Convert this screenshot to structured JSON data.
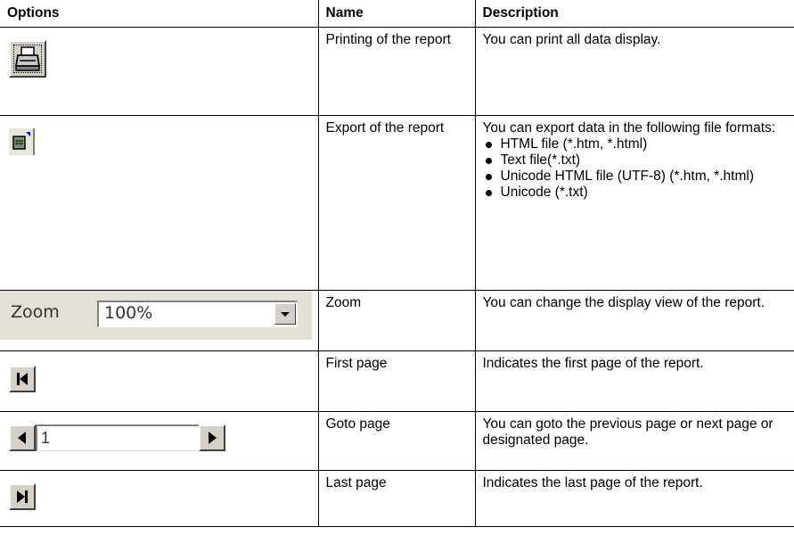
{
  "headers": {
    "options": "Options",
    "name": "Name",
    "description": "Description"
  },
  "rows": [
    {
      "name": "Printing of the report",
      "description": "You can print all data display."
    },
    {
      "name": "Export of the report",
      "description": "You can export data in the following file formats:",
      "formats": [
        "HTML file (*.htm, *.html)",
        "Text file(*.txt)",
        "Unicode HTML file (UTF-8) (*.htm, *.html)",
        "Unicode (*.txt)"
      ]
    },
    {
      "name": "Zoom",
      "description": "You can change the display view of the report."
    },
    {
      "name": "First page",
      "description": "Indicates the first page of the report."
    },
    {
      "name": "Goto page",
      "description": "You can goto the previous page or next page or designated page."
    },
    {
      "name": "Last page",
      "description": "Indicates the last page of the report."
    }
  ],
  "zoom": {
    "label": "Zoom",
    "value": "100%"
  },
  "goto": {
    "page_value": "1"
  },
  "icons": {
    "print": "printer-icon",
    "export": "export-icon",
    "zoom_dropdown": "chevron-down-icon",
    "first": "first-page-icon",
    "prev": "previous-page-icon",
    "next": "next-page-icon",
    "last": "last-page-icon"
  }
}
